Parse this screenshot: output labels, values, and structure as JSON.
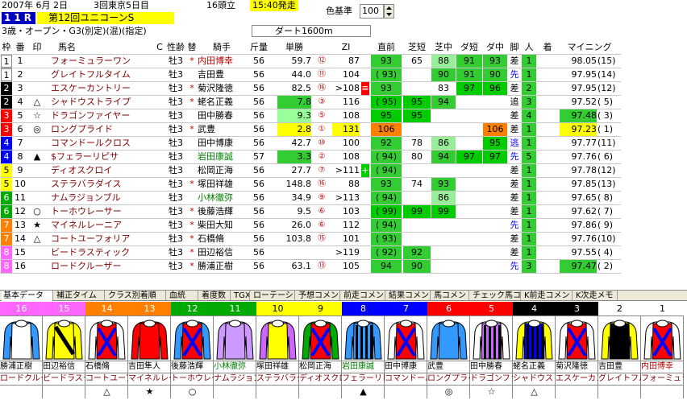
{
  "race": {
    "date": "2007年 6月 2日",
    "meeting": "3回東京5日目",
    "field_count": "16頭立",
    "start_time": "15:40発走",
    "number": "11R",
    "title": "第12回ユニコーンS",
    "conditions": "3歳・オープン・G3(別定)(混)(指定)",
    "course": "ダート1600m",
    "color_std_label": "色基準",
    "color_std_value": "100"
  },
  "colors": {
    "accent_blue": "#0000c0",
    "green": "#33cc33",
    "yellow": "#ffff00",
    "orange": "#ff8000",
    "gold": "#cccc00"
  },
  "columns": [
    "枠",
    "番",
    "印",
    "馬名",
    "C",
    "性齢",
    "替",
    "騎手",
    "斤量",
    "単勝",
    "ZI",
    "直前",
    "芝短",
    "芝中",
    "ダ短",
    "ダ中",
    "脚",
    "人",
    "着",
    "マイニング"
  ],
  "rows": [
    {
      "waku": "1",
      "ban": "1",
      "mark": "",
      "name": "フォーミュラーワン",
      "c": "",
      "sexage": "牡3",
      "kae": "*",
      "jockey": "内田博幸",
      "jockey_hl": true,
      "kin": "56",
      "odds": "59.7",
      "pop": "⑫",
      "zi": "87",
      "zim": "",
      "cho": "93",
      "sh": "65",
      "sm": "88",
      "ds": "91",
      "dm": "93",
      "kyaku": "差",
      "nin": "1",
      "chaku": "",
      "mining": "98.05",
      "mrank": "(15)"
    },
    {
      "waku": "1",
      "ban": "2",
      "mark": "",
      "name": "グレイトフルタイム",
      "c": "",
      "sexage": "牡3",
      "kae": "",
      "jockey": "吉田豊",
      "jockey_hl": false,
      "kin": "56",
      "odds": "44.0",
      "pop": "⑪",
      "zi": "104",
      "zim": "",
      "cho": "( 93)",
      "sh": "",
      "sm": "90",
      "ds": "91",
      "dm": "90",
      "kyaku": "先",
      "nin": "1",
      "chaku": "",
      "mining": "97.95",
      "mrank": "(14)"
    },
    {
      "waku": "2",
      "ban": "3",
      "mark": "",
      "name": "エスケーカントリー",
      "c": "",
      "sexage": "牡3",
      "kae": "*",
      "jockey": "菊沢隆徳",
      "jockey_hl": false,
      "kin": "56",
      "odds": "82.5",
      "pop": "⑯",
      "zi": ">108",
      "zim": "red",
      "cho": "93",
      "sh": "",
      "sm": "83",
      "ds": "97",
      "dm": "96",
      "kyaku": "差",
      "nin": "2",
      "chaku": "",
      "mining": "97.95",
      "mrank": "(12)"
    },
    {
      "waku": "2",
      "ban": "4",
      "mark": "△",
      "name": "シャドウストライプ",
      "c": "",
      "sexage": "牡3",
      "kae": "*",
      "jockey": "蛯名正義",
      "jockey_hl": false,
      "kin": "56",
      "odds": "7.8",
      "pop": "③",
      "zi": "116",
      "zim": "",
      "cho": "( 95)",
      "sh": "95",
      "sm": "94",
      "ds": "",
      "dm": "",
      "kyaku": "追",
      "nin": "3",
      "chaku": "",
      "mining": "97.52",
      "mrank": "( 5)"
    },
    {
      "waku": "3",
      "ban": "5",
      "mark": "☆",
      "name": "ドラゴンファイヤー",
      "c": "",
      "sexage": "牡3",
      "kae": "",
      "jockey": "田中勝春",
      "jockey_hl": false,
      "kin": "56",
      "odds": "9.3",
      "pop": "⑤",
      "zi": "108",
      "zim": "",
      "cho": "95",
      "sh": "95",
      "sm": "",
      "ds": "",
      "dm": "",
      "kyaku": "差",
      "nin": "4",
      "chaku": "",
      "mining": "97.48",
      "mrank": "( 3)"
    },
    {
      "waku": "3",
      "ban": "6",
      "mark": "◎",
      "name": "ロングプライド",
      "c": "",
      "sexage": "牡3",
      "kae": "*",
      "jockey": "武豊",
      "jockey_hl": false,
      "kin": "56",
      "odds": "2.8",
      "pop": "①",
      "zi": "131",
      "zim": "",
      "cho": "106",
      "sh": "",
      "sm": "",
      "ds": "",
      "dm": "106",
      "kyaku": "差",
      "nin": "1",
      "chaku": "",
      "mining": "97.23",
      "mrank": "( 1)"
    },
    {
      "waku": "4",
      "ban": "7",
      "mark": "",
      "name": "コマンドールクロス",
      "c": "",
      "sexage": "牡3",
      "kae": "",
      "jockey": "田中博康",
      "jockey_hl": false,
      "kin": "56",
      "odds": "42.7",
      "pop": "⑩",
      "zi": "100",
      "zim": "",
      "cho": "92",
      "sh": "78",
      "sm": "86",
      "ds": "",
      "dm": "95",
      "kyaku": "逃",
      "nin": "1",
      "chaku": "",
      "mining": "97.77",
      "mrank": "(11)"
    },
    {
      "waku": "4",
      "ban": "8",
      "mark": "▲",
      "name": "$フェラーリピサ",
      "c": "",
      "sexage": "牡3",
      "kae": "",
      "jockey": "岩田康誠",
      "jockey_hl": false,
      "kin": "57",
      "odds": "3.3",
      "pop": "②",
      "zi": "108",
      "zim": "",
      "cho": "( 94)",
      "sh": "80",
      "sm": "94",
      "ds": "97",
      "dm": "97",
      "kyaku": "先",
      "nin": "5",
      "chaku": "",
      "mining": "97.76",
      "mrank": "( 6)"
    },
    {
      "waku": "5",
      "ban": "9",
      "mark": "",
      "name": "ディオスクロイ",
      "c": "",
      "sexage": "牡3",
      "kae": "",
      "jockey": "松岡正海",
      "jockey_hl": false,
      "kin": "56",
      "odds": "27.7",
      "pop": "⑦",
      "zi": ">111",
      "zim": "green",
      "cho": "( 94)",
      "sh": "",
      "sm": "",
      "ds": "",
      "dm": "",
      "kyaku": "差",
      "nin": "1",
      "chaku": "",
      "mining": "97.78",
      "mrank": "(12)"
    },
    {
      "waku": "5",
      "ban": "10",
      "mark": "",
      "name": "ステラバラダイス",
      "c": "",
      "sexage": "牡3",
      "kae": "*",
      "jockey": "塚田祥雄",
      "jockey_hl": false,
      "kin": "56",
      "odds": "148.8",
      "pop": "⑯",
      "zi": "88",
      "zim": "",
      "cho": "93",
      "sh": "74",
      "sm": "93",
      "ds": "",
      "dm": "",
      "kyaku": "差",
      "nin": "1",
      "chaku": "",
      "mining": "97.85",
      "mrank": "(13)"
    },
    {
      "waku": "6",
      "ban": "11",
      "mark": "",
      "name": "ナムラジョンブル",
      "c": "",
      "sexage": "牡3",
      "kae": "",
      "jockey": "小林徹弥",
      "jockey_hl": false,
      "kin": "56",
      "odds": "34.9",
      "pop": "⑨",
      "zi": ">113",
      "zim": "",
      "cho": "( 94)",
      "sh": "",
      "sm": "86",
      "ds": "",
      "dm": "",
      "kyaku": "差",
      "nin": "1",
      "chaku": "",
      "mining": "97.65",
      "mrank": "( 8)"
    },
    {
      "waku": "6",
      "ban": "12",
      "mark": "○",
      "name": "トーホウレーサー",
      "c": "",
      "sexage": "牡3",
      "kae": "*",
      "jockey": "後藤浩輝",
      "jockey_hl": false,
      "kin": "56",
      "odds": "9.5",
      "pop": "⑥",
      "zi": "103",
      "zim": "",
      "cho": "( 99)",
      "sh": "99",
      "sm": "99",
      "ds": "",
      "dm": "",
      "kyaku": "差",
      "nin": "1",
      "chaku": "",
      "mining": "97.62",
      "mrank": "( 7)"
    },
    {
      "waku": "7",
      "ban": "13",
      "mark": "★",
      "name": "マイネルレーニア",
      "c": "",
      "sexage": "牡3",
      "kae": "*",
      "jockey": "柴田大知",
      "jockey_hl": false,
      "kin": "56",
      "odds": "26.0",
      "pop": "⑥",
      "zi": "112",
      "zim": "",
      "cho": "( 94)",
      "sh": "",
      "sm": "",
      "ds": "",
      "dm": "",
      "kyaku": "先",
      "nin": "1",
      "chaku": "",
      "mining": "97.86",
      "mrank": "( 9)"
    },
    {
      "waku": "7",
      "ban": "14",
      "mark": "△",
      "name": "コートユーフォリア",
      "c": "",
      "sexage": "牡3",
      "kae": "*",
      "jockey": "石橋脩",
      "jockey_hl": false,
      "kin": "56",
      "odds": "103.8",
      "pop": "⑮",
      "zi": "101",
      "zim": "",
      "cho": "( 93)",
      "sh": "",
      "sm": "",
      "ds": "",
      "dm": "",
      "kyaku": "差",
      "nin": "1",
      "chaku": "",
      "mining": "97.76",
      "mrank": "(10)"
    },
    {
      "waku": "8",
      "ban": "15",
      "mark": "",
      "name": "ビードラスティック",
      "c": "",
      "sexage": "牡3",
      "kae": "*",
      "jockey": "田辺裕信",
      "jockey_hl": false,
      "kin": "56",
      "odds": "",
      "pop": "",
      "zi": ">119",
      "zim": "",
      "cho": "( 92)",
      "sh": "92",
      "sm": "",
      "ds": "",
      "dm": "",
      "kyaku": "差",
      "nin": "1",
      "chaku": "",
      "mining": "97.55",
      "mrank": "( 4)"
    },
    {
      "waku": "8",
      "ban": "16",
      "mark": "",
      "name": "ロードクルーザー",
      "c": "",
      "sexage": "牡3",
      "kae": "*",
      "jockey": "勝浦正樹",
      "jockey_hl": false,
      "kin": "56",
      "odds": "63.1",
      "pop": "⑬",
      "zi": "105",
      "zim": "",
      "cho": "94",
      "sh": "90",
      "sm": "",
      "ds": "",
      "dm": "",
      "kyaku": "先",
      "nin": "3",
      "chaku": "",
      "mining": "97.47",
      "mrank": "( 2)"
    }
  ],
  "tabs": [
    "基本データ",
    "補正タイム",
    "クラス別着順",
    "血統",
    "着度数",
    "TGX",
    "ローテーション",
    "予想コメント",
    "前走コメント",
    "結果コメント",
    "馬コメント",
    "チェック馬コメント",
    "K前走コメント",
    "K次走メモ"
  ],
  "silks": [
    {
      "num": "16",
      "jockey": "勝浦正樹",
      "horse": "ロードクルーザ",
      "mark": ""
    },
    {
      "num": "15",
      "jockey": "田辺裕信",
      "horse": "ビードラスティ",
      "mark": ""
    },
    {
      "num": "14",
      "jockey": "石橋脩",
      "horse": "コートユーフ",
      "mark": "△"
    },
    {
      "num": "13",
      "jockey": "吉田隼人",
      "horse": "マイネルレー",
      "mark": "★"
    },
    {
      "num": "12",
      "jockey": "後藤浩輝",
      "horse": "トーホウレー",
      "mark": "○"
    },
    {
      "num": "11",
      "jockey": "小林徹弥",
      "horse": "ナムラジョン",
      "mark": ""
    },
    {
      "num": "10",
      "jockey": "塚田祥雄",
      "horse": "ステラバラダ",
      "mark": ""
    },
    {
      "num": "9",
      "jockey": "松岡正海",
      "horse": "ディオスクロ",
      "mark": ""
    },
    {
      "num": "8",
      "jockey": "岩田康誠",
      "horse": "フェラーリピサ",
      "mark": "▲"
    },
    {
      "num": "7",
      "jockey": "田中博康",
      "horse": "コマンドール",
      "mark": ""
    },
    {
      "num": "6",
      "jockey": "武豊",
      "horse": "ロングプライ",
      "mark": "◎"
    },
    {
      "num": "5",
      "jockey": "田中勝春",
      "horse": "ドラゴンファ",
      "mark": "☆"
    },
    {
      "num": "4",
      "jockey": "蛯名正義",
      "horse": "シャドウスト",
      "mark": "△"
    },
    {
      "num": "3",
      "jockey": "菊沢隆徳",
      "horse": "エスケーカン",
      "mark": ""
    },
    {
      "num": "2",
      "jockey": "吉田豊",
      "horse": "グレイトフル",
      "mark": ""
    },
    {
      "num": "1",
      "jockey": "内田博幸",
      "horse": "フォーミュラ",
      "mark": ""
    }
  ]
}
